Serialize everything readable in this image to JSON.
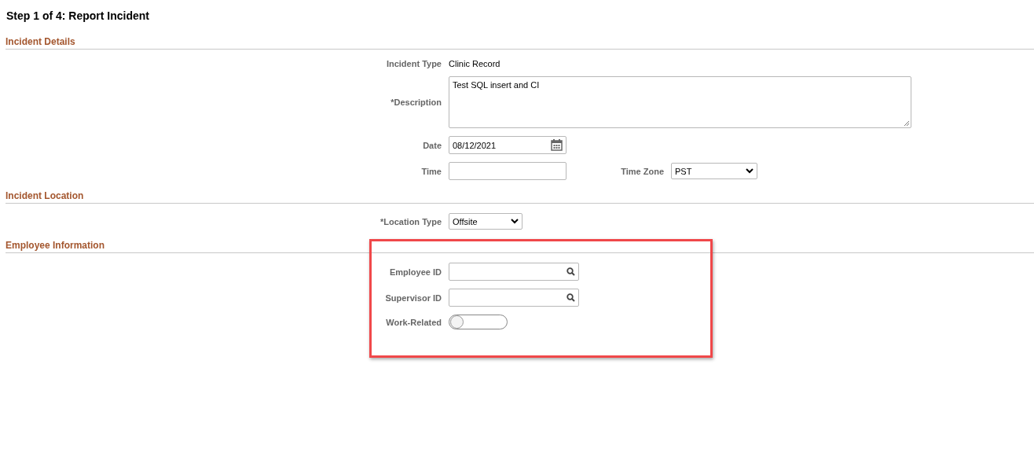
{
  "title": "Step 1 of 4: Report Incident",
  "sections": [
    {
      "heading": "Incident Details",
      "highlighted": false,
      "rows": [
        {
          "fields": [
            {
              "kind": "display",
              "label": "Incident Type",
              "value": "Clinic Record"
            }
          ]
        },
        {
          "fields": [
            {
              "kind": "textarea",
              "label": "*Description",
              "value": "Test SQL insert and CI"
            }
          ]
        },
        {
          "fields": [
            {
              "kind": "date",
              "label": "Date",
              "value": "08/12/2021"
            }
          ]
        },
        {
          "fields": [
            {
              "kind": "text",
              "label": "Time"
            },
            {
              "kind": "select",
              "label": "Time Zone",
              "value": "PST"
            }
          ]
        }
      ]
    },
    {
      "heading": "Incident Location",
      "highlighted": false,
      "rows": [
        {
          "fields": [
            {
              "kind": "select",
              "label": "*Location Type",
              "value": "Offsite"
            }
          ]
        }
      ]
    },
    {
      "heading": "Employee Information",
      "highlighted": true,
      "rows": [
        {
          "fields": [
            {
              "kind": "lookup",
              "label": "Employee ID"
            }
          ]
        },
        {
          "fields": [
            {
              "kind": "lookup",
              "label": "Supervisor ID"
            }
          ]
        },
        {
          "fields": [
            {
              "kind": "toggle",
              "label": "Work-Related",
              "on": false
            }
          ]
        }
      ]
    }
  ]
}
